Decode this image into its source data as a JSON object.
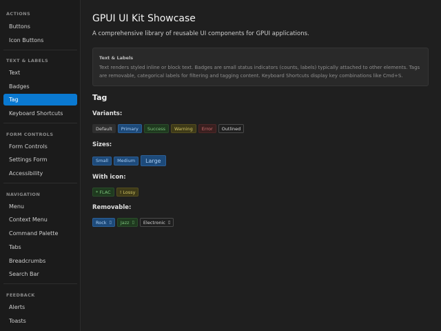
{
  "sidebar": {
    "sections": [
      {
        "title": "ACTIONS",
        "items": [
          "Buttons",
          "Icon Buttons"
        ]
      },
      {
        "title": "TEXT & LABELS",
        "items": [
          "Text",
          "Badges",
          "Tag",
          "Keyboard Shortcuts"
        ]
      },
      {
        "title": "FORM CONTROLS",
        "items": [
          "Form Controls",
          "Settings Form",
          "Accessibility"
        ]
      },
      {
        "title": "NAVIGATION",
        "items": [
          "Menu",
          "Context Menu",
          "Command Palette",
          "Tabs",
          "Breadcrumbs",
          "Search Bar"
        ]
      },
      {
        "title": "FEEDBACK",
        "items": [
          "Alerts",
          "Toasts"
        ]
      }
    ],
    "active_item": "Tag"
  },
  "main": {
    "title": "GPUI UI Kit Showcase",
    "subtitle": "A comprehensive library of reusable UI components for GPUI applications.",
    "info": {
      "title": "Text & Labels",
      "text": "Text renders styled inline or block text. Badges are small status indicators (counts, labels) typically attached to other elements. Tags are removable, categorical labels for filtering and tagging content. Keyboard Shortcuts display key combinations like Cmd+S."
    },
    "section_title": "Tag",
    "variants": {
      "label": "Variants:",
      "tags": [
        "Default",
        "Primary",
        "Success",
        "Warning",
        "Error",
        "Outlined"
      ]
    },
    "sizes": {
      "label": "Sizes:",
      "tags": [
        "Small",
        "Medium",
        "Large"
      ]
    },
    "with_icon": {
      "label": "With icon:",
      "tags": [
        "* FLAC",
        "! Lossy"
      ]
    },
    "removable": {
      "label": "Removable:",
      "tags": [
        "Rock",
        "Jazz",
        "Electronic"
      ],
      "remove_glyph": "▯"
    }
  }
}
